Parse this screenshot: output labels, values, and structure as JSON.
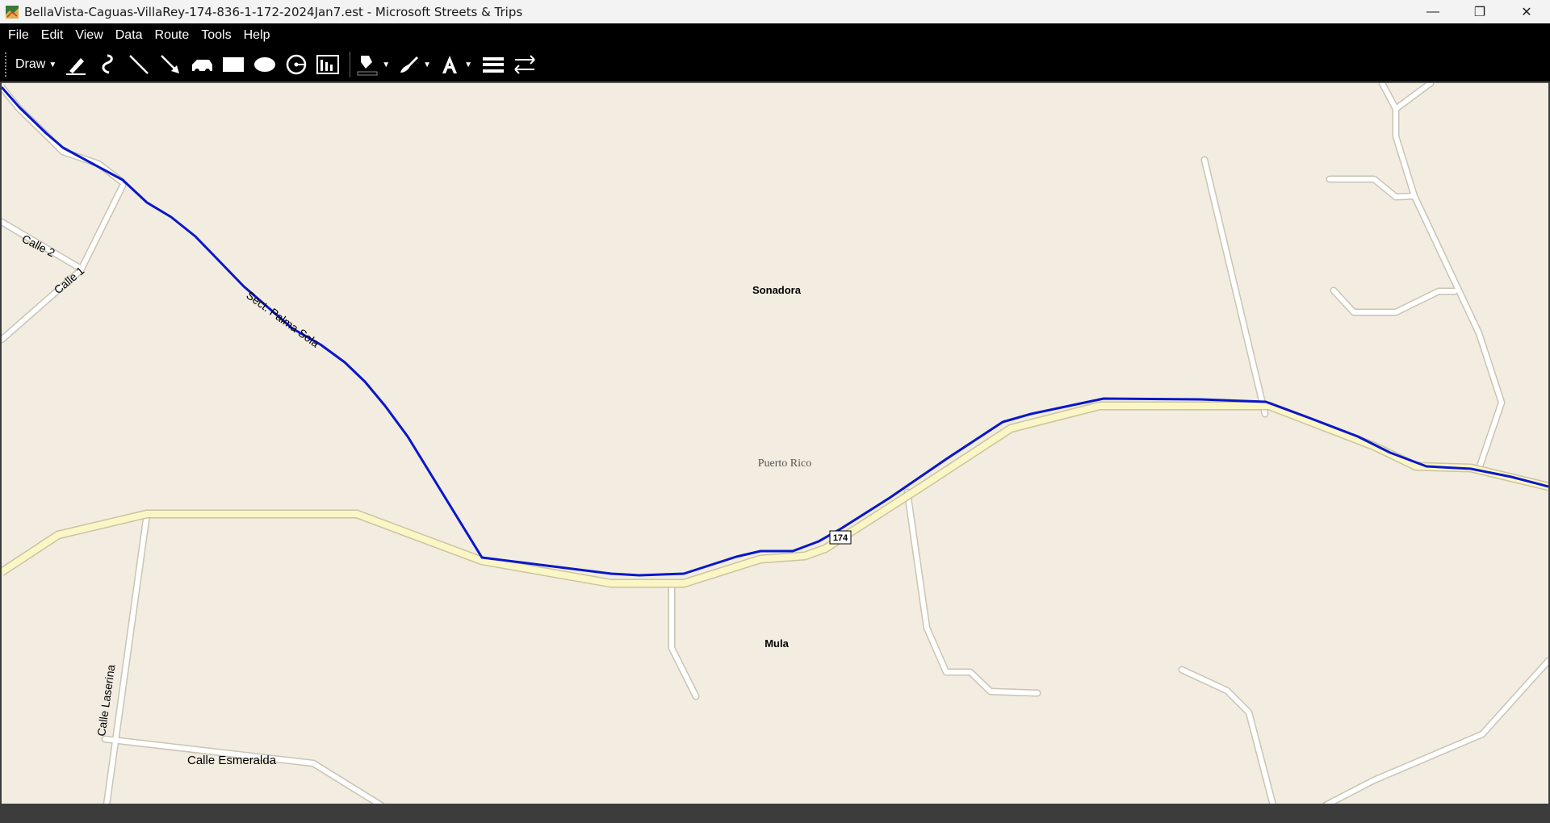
{
  "window": {
    "title": "BellaVista-Caguas-VillaRey-174-836-1-172-2024Jan7.est - Microsoft Streets & Trips",
    "minimize_glyph": "—",
    "maximize_glyph": "❐",
    "close_glyph": "✕"
  },
  "menu": {
    "items": [
      {
        "label": "File"
      },
      {
        "label": "Edit"
      },
      {
        "label": "View"
      },
      {
        "label": "Data"
      },
      {
        "label": "Route"
      },
      {
        "label": "Tools"
      },
      {
        "label": "Help"
      }
    ]
  },
  "toolbar": {
    "draw_label": "Draw",
    "tools": [
      "highlighter-icon",
      "freeform-icon",
      "line-icon",
      "arrow-icon",
      "pushpin-icon",
      "rectangle-icon",
      "oval-icon",
      "radius-circle-icon",
      "chart-icon",
      "fill-color-icon",
      "line-color-icon",
      "font-icon",
      "line-style-icon",
      "swap-icon"
    ]
  },
  "map": {
    "background_color": "#f2ede0",
    "route_color": "#0a17c9",
    "highway_color": "#fbf6c6",
    "road_color": "#ffffff",
    "labels": {
      "sonadora": "Sonadora",
      "puerto_rico": "Puerto Rico",
      "mula": "Mula",
      "calle_2": "Calle 2",
      "calle_1": "Calle 1",
      "sect_palma_sola": "Sect. Palma Sola",
      "calle_laserina": "Calle Laserina",
      "calle_esmeralda": "Calle Esmeralda",
      "route_shield": "174"
    }
  }
}
